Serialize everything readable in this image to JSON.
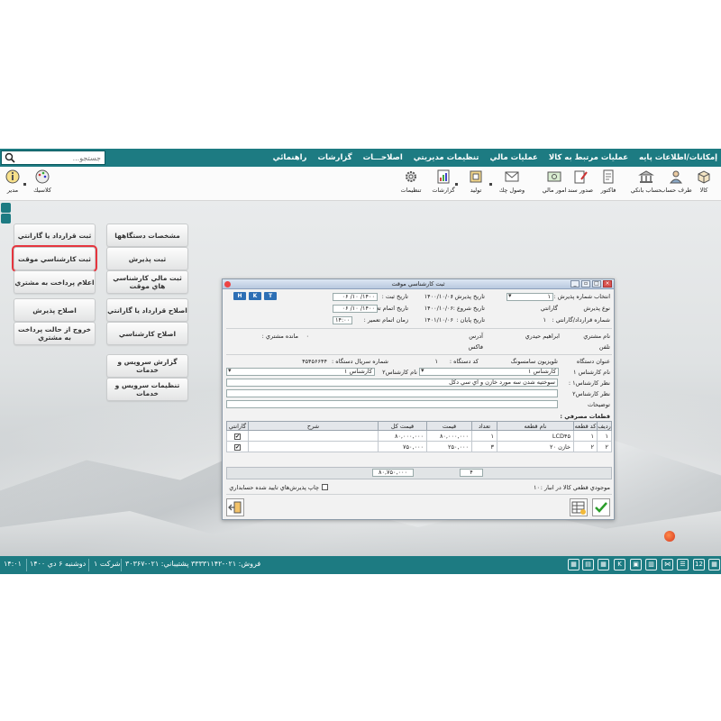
{
  "search": {
    "placeholder": "جستجو..."
  },
  "menu": [
    "إمكانات/اطلاعات پايه",
    "عمليات مرتبط به كالا",
    "عمليات مالي",
    "تنظيمات مديريتي",
    "اصلاحـــات",
    "گزارشات",
    "راهنمائي"
  ],
  "toolbar": {
    "kala": "كالا",
    "taraf": "طرف حساب",
    "bank": "حساب بانكي",
    "factor": "فاكتور",
    "sodur": "صدور سند",
    "mali": "امور مالي",
    "chek": "وصول چك",
    "tolid": "توليد",
    "gozareshat": "گزارشات",
    "tanzimat": "تنظيمات",
    "classic": "كلاسيك",
    "modir": "مدير"
  },
  "desktop_buttons": {
    "col1": [
      "ثبت قرارداد يا گارانتي",
      "ثبت كارشناسي موقت",
      "اعلام پرداخت به مشتري",
      "اصلاح پذيرش",
      "خروج از حالت پرداخت به مشتري"
    ],
    "col2": [
      "مشخصات دستگاهها",
      "ثبت پذيرش",
      "ثبت مالي كارشناسي هاي موقت",
      "اصلاح قرارداد يا گارانتي",
      "اصلاح كارشناسي",
      "گزارش سرويس و خدمات",
      "تنظيمات سرويس و خدمات"
    ]
  },
  "dialog": {
    "title": "ثبت كارشناسي موقت",
    "hkt": [
      "H",
      "K",
      "T"
    ],
    "labels": {
      "select_reception": "انتخاب شماره پذيرش :",
      "reception_type": "نوع پذيرش",
      "contract_no": "شماره قرارداد/گارانتي :",
      "reception_date": "تاريخ پذيرش :",
      "start_date": "تاريخ شروع :",
      "end_date": "تاريخ پايان :",
      "reg_date": "تاريخ ثبت :",
      "repair_date": "تاريخ اتمام تعمير :",
      "repair_time": "زمان اتمام تعمير :",
      "customer_name": "نام مشتري",
      "address": "آدرس",
      "phone": "تلفن",
      "fax": "فاكس",
      "customer_balance": "مانده مشتري :",
      "device_title": "عنوان دستگاه",
      "device_code": "كد دستگاه :",
      "serial_no": "شماره سريال دستگاه :",
      "expert1": "نام كارشناس ۱",
      "expert2": "نام كارشناس۲",
      "expert1_opinion": "نظر كارشناس۱ :",
      "expert2_opinion": "نظر كارشناس۲",
      "description": "توضيحات",
      "used_parts": "قطعات مصرفي :",
      "print_receptions": "چاپ پذيرش‌هاي تاييد شده حسابداري",
      "stock": "موجودي قطعي كالا در انبار :"
    },
    "values": {
      "reception_no": "۱",
      "reception_type": "گارانتي",
      "contract_no": "۱",
      "reception_date": "۱۴۰۰/۱۰/۰۶",
      "start_date": "۱۴۰۰/۱۰/۰۶",
      "end_date": "۱۴۰۱/۱۰/۰۶",
      "reg_date": "۱۴۰۰/ ۱۰/ ۰۶",
      "repair_date": "۱۴۰۰/ ۱۰/ ۰۶",
      "repair_time": "۱۴:۰۰",
      "customer_name": "ابراهيم حيدري",
      "customer_balance": "۰",
      "device_title": "تلويزيون سامسونگ",
      "device_code": "۱",
      "serial_no": "۴۵۴۵۶۶۴۴",
      "expert1": "كارشناس ۱",
      "expert2": "كارشناس ۱",
      "expert1_opinion": "سوختيه شدن سه مورد خازن و اي سي دكل",
      "stock": "۱۰"
    },
    "parts_table": {
      "headers": [
        "رديف",
        "كد قطعه",
        "نام قطعه",
        "تعداد",
        "قيمت",
        "قيمت كل",
        "شرح",
        "گارانتي"
      ],
      "rows": [
        {
          "row": "۱",
          "code": "۱",
          "name": "LCD۴۵",
          "qty": "۱",
          "price": "۸۰,۰۰۰,۰۰۰",
          "total": "۸۰,۰۰۰,۰۰۰",
          "desc": "",
          "warranty": "✔"
        },
        {
          "row": "۲",
          "code": "۲",
          "name": "خازن ۲۰",
          "qty": "۳",
          "price": "۲۵۰,۰۰۰",
          "total": "۷۵۰,۰۰۰",
          "desc": "",
          "warranty": "✔"
        }
      ]
    },
    "totals": {
      "qty": "۴",
      "total": "۸۰,۷۵۰,۰۰۰"
    }
  },
  "statusbar": {
    "time": "۱۴:۰۱",
    "date": "دوشنبه ۶ دي ۱۴۰۰",
    "company": "شركت ۱",
    "phones": "فروش: ۰۲۱-۳۳۳۳۱۱۴۲ پشتيباني: ۰۲۱-۳۰۳۶۷"
  }
}
